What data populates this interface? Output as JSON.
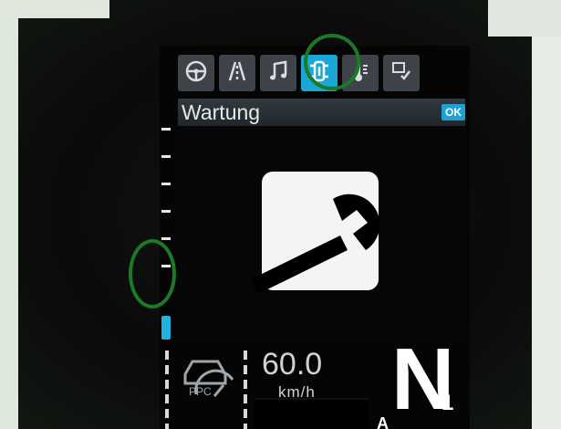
{
  "header": {
    "title": "Wartung",
    "ok_label": "OK"
  },
  "tabs": [
    {
      "icon": "steering-wheel-icon",
      "active": false
    },
    {
      "icon": "road-icon",
      "active": false
    },
    {
      "icon": "music-note-icon",
      "active": false
    },
    {
      "icon": "vehicle-service-icon",
      "active": true
    },
    {
      "icon": "thermometer-icon",
      "active": false
    },
    {
      "icon": "settings-check-icon",
      "active": false
    }
  ],
  "main": {
    "icon": "wrench-icon"
  },
  "status": {
    "speed": "60.0",
    "speed_unit": "km/h",
    "gear": "N",
    "gear_sub": "1",
    "ppc_label": "PPC",
    "auto_label": "A"
  },
  "colors": {
    "accent": "#19a7d6",
    "marker": "#1a7a25",
    "background": "#050505"
  }
}
